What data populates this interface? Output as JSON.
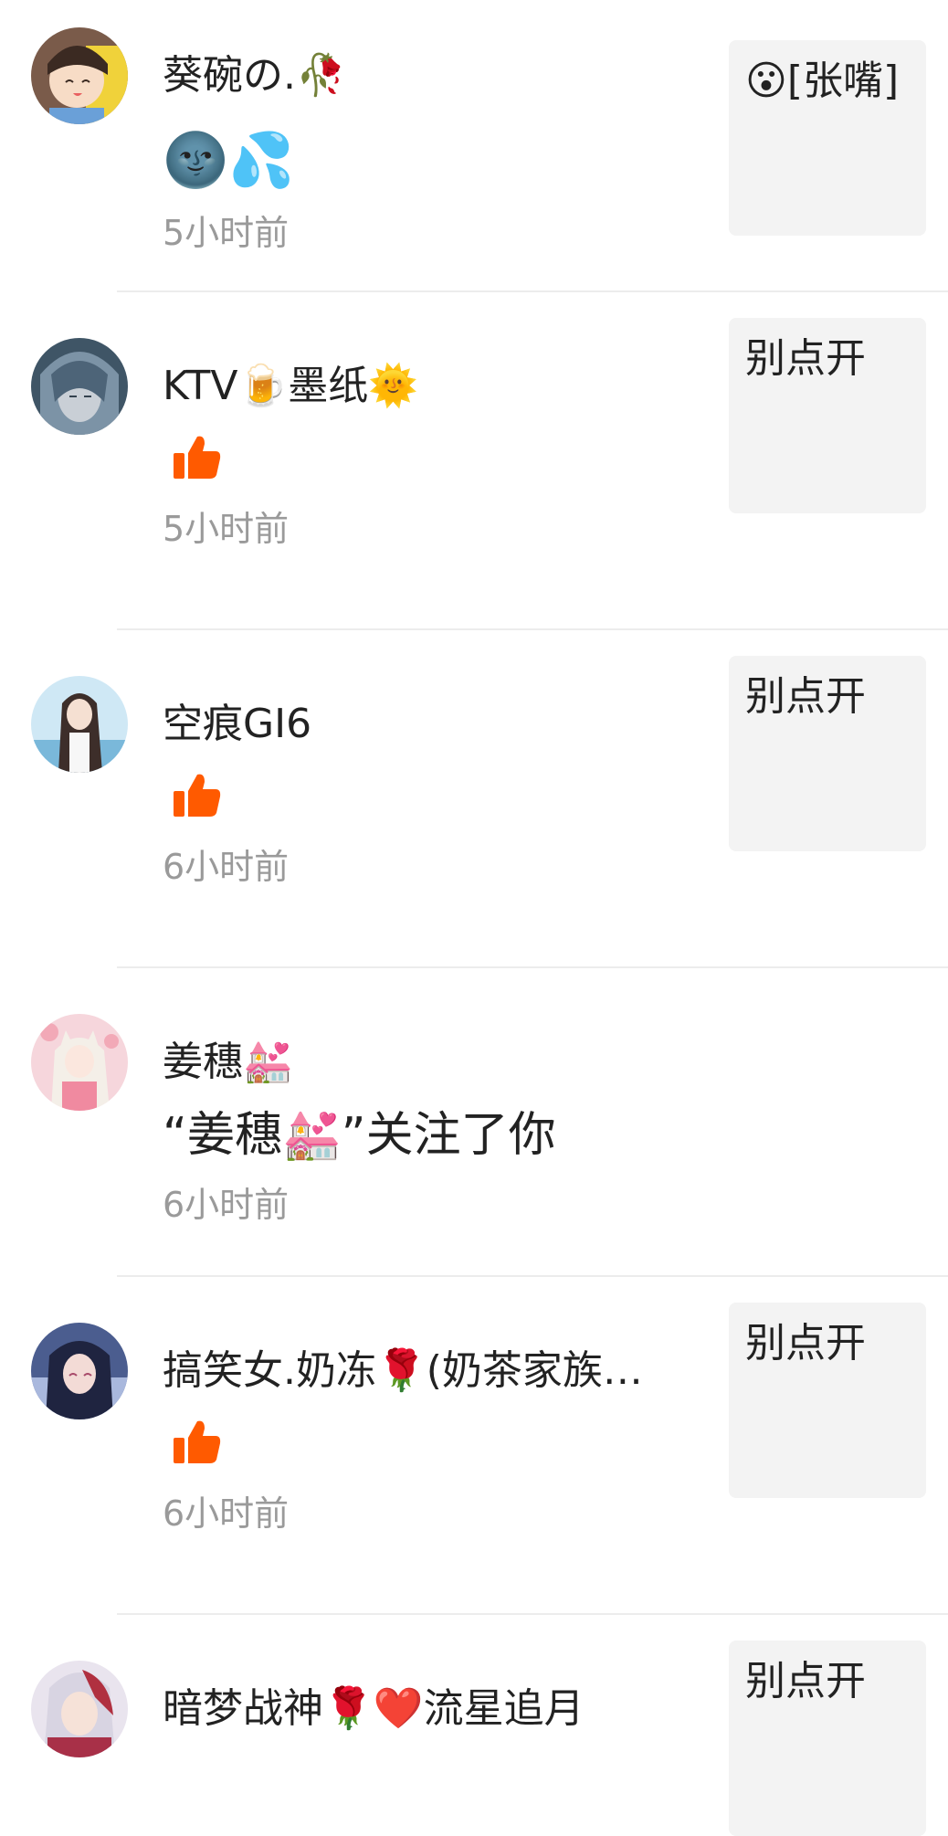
{
  "items": [
    {
      "name": "葵碗の.🥀",
      "content_emoji": "🌚💦",
      "time": "5小时前",
      "quote": "😮[张嘴]"
    },
    {
      "name": "KTV🍺墨纸🌞",
      "time": "5小时前",
      "quote": "别点开"
    },
    {
      "name": "空痕GI6",
      "time": "6小时前",
      "quote": "别点开"
    },
    {
      "name": "姜穗💒",
      "follow_text": "“姜穗💒”关注了你",
      "time": "6小时前"
    },
    {
      "name": "搞笑女.奶冻🌹(奶茶家族…",
      "time": "6小时前",
      "quote": "别点开"
    },
    {
      "name": "暗梦战神🌹❤️流星追月",
      "quote": "别点开"
    }
  ],
  "colors": {
    "like": "#ff5a00",
    "time": "#9a9a9a",
    "quote_bg": "#f3f3f3",
    "divider": "#ececec"
  },
  "icons": {
    "like": "thumbs-up-icon"
  }
}
